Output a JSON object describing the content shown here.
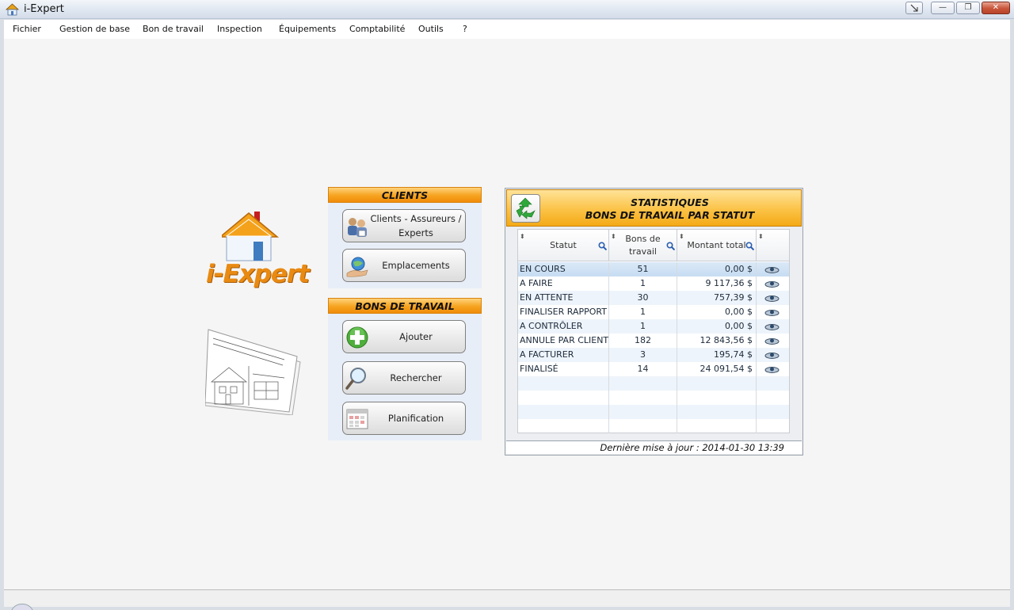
{
  "window": {
    "title": "i-Expert",
    "controls": {
      "minimize": "—",
      "restore": "❐",
      "close": "✕"
    }
  },
  "menu": {
    "items": [
      "Fichier",
      "Gestion de base",
      "Bon de travail",
      "Inspection",
      "Équipements",
      "Comptabilité",
      "Outils",
      "?"
    ]
  },
  "logo": {
    "text": "i-Expert"
  },
  "clients": {
    "header": "CLIENTS",
    "buttons": [
      {
        "label": "Clients - Assureurs / Experts",
        "icon": "people-icon"
      },
      {
        "label": "Emplacements",
        "icon": "globe-hand-icon"
      }
    ]
  },
  "bons": {
    "header": "BONS DE TRAVAIL",
    "buttons": [
      {
        "label": "Ajouter",
        "icon": "add-plus-icon"
      },
      {
        "label": "Rechercher",
        "icon": "magnifier-icon"
      },
      {
        "label": "Planification",
        "icon": "calendar-icon"
      }
    ]
  },
  "stats": {
    "title_line1": "STATISTIQUES",
    "title_line2": "BONS DE TRAVAIL PAR STATUT",
    "columns": [
      "Statut",
      "Bons de travail",
      "Montant total"
    ],
    "rows": [
      {
        "statut": "EN COURS",
        "bons": "51",
        "montant": "0,00 $"
      },
      {
        "statut": "A FAIRE",
        "bons": "1",
        "montant": "9 117,36 $"
      },
      {
        "statut": "EN ATTENTE",
        "bons": "30",
        "montant": "757,39 $"
      },
      {
        "statut": "FINALISER RAPPORT",
        "bons": "1",
        "montant": "0,00 $"
      },
      {
        "statut": "A CONTRÔLER",
        "bons": "1",
        "montant": "0,00 $"
      },
      {
        "statut": "ANNULE PAR CLIENT",
        "bons": "182",
        "montant": "12 843,56 $"
      },
      {
        "statut": "A FACTURER",
        "bons": "3",
        "montant": "195,74 $"
      },
      {
        "statut": "FINALISÉ",
        "bons": "14",
        "montant": "24 091,54 $"
      }
    ],
    "footer": "Dernière mise à jour : 2014-01-30 13:39"
  },
  "colors": {
    "accent_orange": "#f6a31f",
    "panel_blue": "#e8eef7",
    "selected_row": "#c6dcf2"
  }
}
